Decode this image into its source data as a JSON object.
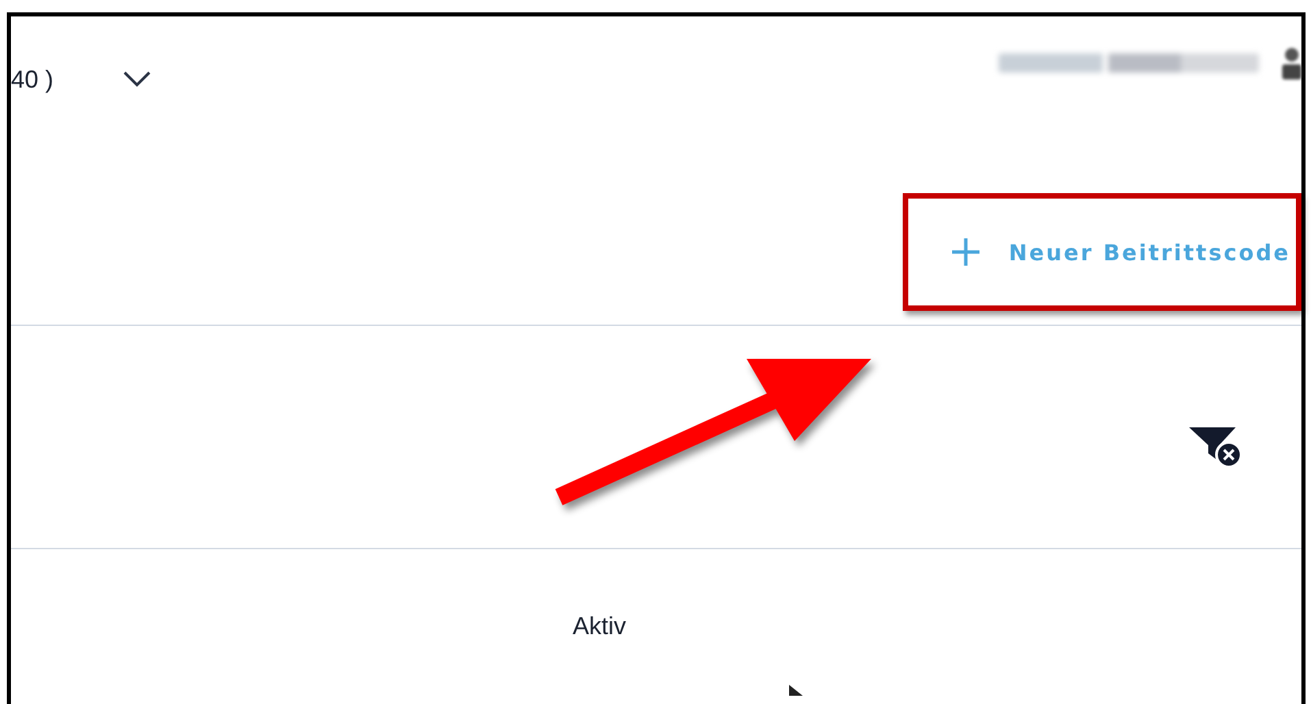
{
  "header": {
    "page_size": "40 )"
  },
  "toolbar": {
    "new_button": {
      "label": "Neuer Beitrittscode"
    }
  },
  "filter_bar": {
    "clear_filter": true
  },
  "table": {
    "columns": [
      {
        "label": "Aktiv"
      }
    ]
  }
}
